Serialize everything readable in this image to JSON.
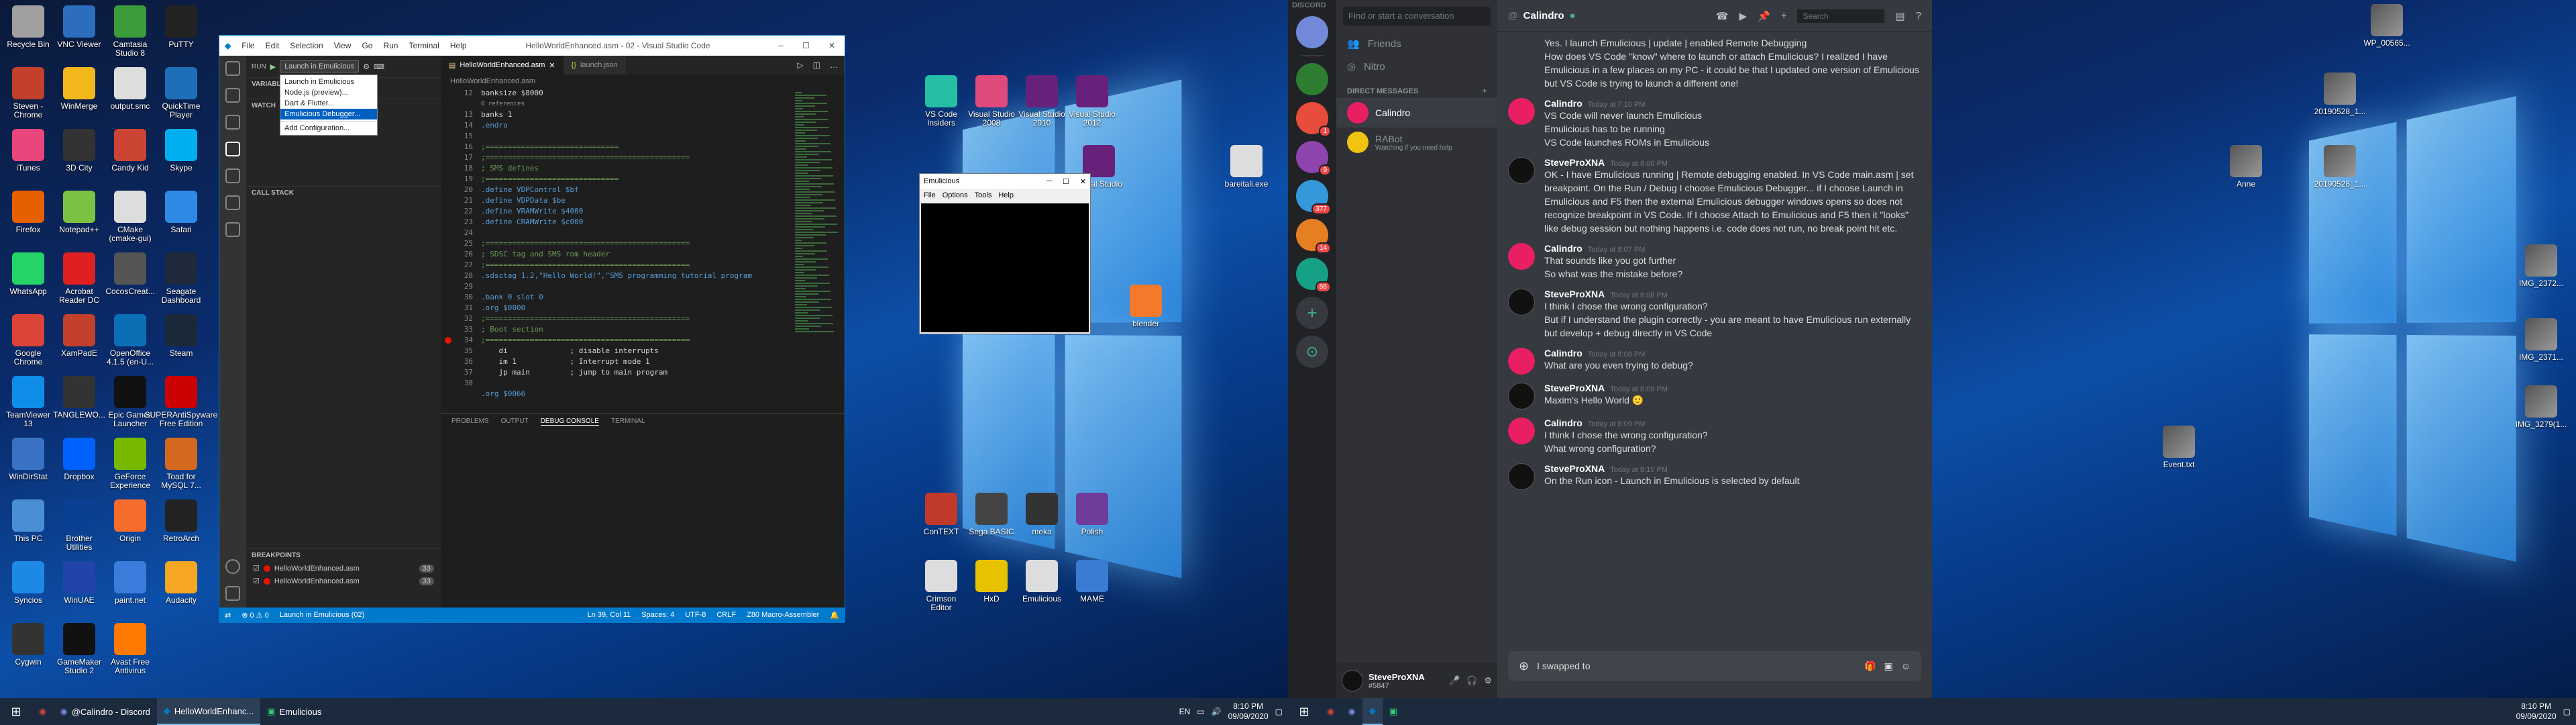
{
  "left_desktop": {
    "icons": [
      {
        "label": "Recycle Bin",
        "color": "#a0a0a0"
      },
      {
        "label": "VNC Viewer",
        "color": "#2c6ebd"
      },
      {
        "label": "Camtasia Studio 8",
        "color": "#3c9c3c"
      },
      {
        "label": "PuTTY",
        "color": "#222"
      },
      {
        "label": "Steven - Chrome",
        "color": "#c2402c"
      },
      {
        "label": "WinMerge",
        "color": "#f2b81b"
      },
      {
        "label": "output.smc",
        "color": "#ddd"
      },
      {
        "label": "QuickTime Player",
        "color": "#1f6fb8"
      },
      {
        "label": "iTunes",
        "color": "#e8467c"
      },
      {
        "label": "3D City",
        "color": "#333"
      },
      {
        "label": "Candy Kid",
        "color": "#c43"
      },
      {
        "label": "Skype",
        "color": "#00aff0"
      },
      {
        "label": "Firefox",
        "color": "#e66000"
      },
      {
        "label": "Notepad++",
        "color": "#7cc242"
      },
      {
        "label": "CMake (cmake-gui)",
        "color": "#ddd"
      },
      {
        "label": "Safari",
        "color": "#2d8be6"
      },
      {
        "label": "WhatsApp",
        "color": "#25d366"
      },
      {
        "label": "Acrobat Reader DC",
        "color": "#e02020"
      },
      {
        "label": "CocosCreat...",
        "color": "#555"
      },
      {
        "label": "Seagate Dashboard",
        "color": "#1e2a3c"
      },
      {
        "label": "Google Chrome",
        "color": "#db4437"
      },
      {
        "label": "XamPadE",
        "color": "#c2402c"
      },
      {
        "label": "OpenOffice 4.1.5 (en-U...",
        "color": "#0b6fb5"
      },
      {
        "label": "Steam",
        "color": "#1b2838"
      },
      {
        "label": "TeamViewer 13",
        "color": "#0e8ee9"
      },
      {
        "label": "TANGLEWO...",
        "color": "#333"
      },
      {
        "label": "Epic Games Launcher",
        "color": "#111"
      },
      {
        "label": "SUPERAntiSpyware Free Edition",
        "color": "#c00"
      },
      {
        "label": "WinDirStat",
        "color": "#3a72c3"
      },
      {
        "label": "Dropbox",
        "color": "#0061ff"
      },
      {
        "label": "GeForce Experience",
        "color": "#76b900"
      },
      {
        "label": "Toad for MySQL 7...",
        "color": "#d2691e"
      },
      {
        "label": "This PC",
        "color": "#4a8fd4"
      },
      {
        "label": "Brother Utilities",
        "color": "#0b3f91"
      },
      {
        "label": "Origin",
        "color": "#f56c2d"
      },
      {
        "label": "RetroArch",
        "color": "#222"
      },
      {
        "label": "Syncios",
        "color": "#1e88e5"
      },
      {
        "label": "WinUAE",
        "color": "#2244aa"
      },
      {
        "label": "paint.net",
        "color": "#3b7ddd"
      },
      {
        "label": "Audacity",
        "color": "#f5a623"
      },
      {
        "label": "Cygwin",
        "color": "#333"
      },
      {
        "label": "GameMaker Studio 2",
        "color": "#111"
      },
      {
        "label": "Avast Free Antivirus",
        "color": "#ff7800"
      }
    ],
    "mid_icons": [
      {
        "label": "VS Code Insiders",
        "color": "#24bfa5"
      },
      {
        "label": "Visual Studio 2008",
        "color": "#e04a7a"
      },
      {
        "label": "Visual Studio 2010",
        "color": "#68217a"
      },
      {
        "label": "Visual Studio 2012",
        "color": "#68217a"
      },
      {
        "label": "Visual Studio",
        "color": "#68217a"
      },
      {
        "label": "blender",
        "color": "#f5792a"
      },
      {
        "label": "bareitali.exe",
        "color": "#ddd"
      },
      {
        "label": "ConTEXT",
        "color": "#c0392b"
      },
      {
        "label": "Sega BASIC",
        "color": "#444"
      },
      {
        "label": "meka",
        "color": "#333"
      },
      {
        "label": "Polish",
        "color": "#6f3c9c"
      },
      {
        "label": "Crimson Editor",
        "color": "#ddd"
      },
      {
        "label": "HxD",
        "color": "#e6c200"
      },
      {
        "label": "Emulicious",
        "color": "#ddd"
      },
      {
        "label": "MAME",
        "color": "#3a7bd5"
      }
    ],
    "taskbar": {
      "items": [
        "@Calindro - Discord",
        "HelloWorldEnhanc...",
        "Emulicious"
      ],
      "lang": "EN",
      "time": "8:10 PM",
      "date": "09/09/2020"
    }
  },
  "vscode": {
    "title": "HelloWorldEnhanced.asm - 02 - Visual Studio Code",
    "menu": [
      "File",
      "Edit",
      "Selection",
      "View",
      "Go",
      "Run",
      "Terminal",
      "Help"
    ],
    "run_label": "RUN",
    "run_config": "Launch in Emulicious",
    "dropdown": [
      "Launch in Emulicious",
      "Node.js (preview)...",
      "Dart & Flutter...",
      "Emulicious Debugger...",
      "Add Configuration..."
    ],
    "sections": [
      "VARIABLES",
      "WATCH",
      "CALL STACK",
      "BREAKPOINTS"
    ],
    "breakpoints": [
      {
        "file": "HelloWorldEnhanced.asm",
        "line": "33"
      },
      {
        "file": "HelloWorldEnhanced.asm",
        "line": "33"
      }
    ],
    "tabs": [
      "HelloWorldEnhanced.asm",
      "launch.json"
    ],
    "breadcrumb": "HelloWorldEnhanced.asm",
    "line_numbers": [
      "12",
      "",
      "13",
      "14",
      "15",
      "16",
      "17",
      "18",
      "19",
      "20",
      "21",
      "22",
      "23",
      "24",
      "25",
      "26",
      "27",
      "28",
      "29",
      "30",
      "31",
      "32",
      "33",
      "34",
      "35",
      "36",
      "37",
      "38"
    ],
    "code_lines": [
      "banksize $8000",
      "0 references",
      "banks 1",
      ".endro",
      "",
      ";==============================",
      ";==============================================",
      "; SMS defines",
      ";==============================",
      ".define VDPControl $bf",
      ".define VDPData $be",
      ".define VRAMWrite $4000",
      ".define CRAMWrite $c000",
      "",
      ";==============================================",
      "; SDSC tag and SMS rom header",
      ";==============================================",
      ".sdsctag 1.2,\"Hello World!\",\"SMS programming tutorial program",
      "",
      ".bank 0 slot 0",
      ".org $0000",
      ";==============================================",
      "; Boot section",
      ";==============================================",
      "    di              ; disable interrupts",
      "    im 1            ; Interrupt mode 1",
      "    jp main         ; jump to main program",
      "",
      ".org $0066"
    ],
    "panel_tabs": [
      "PROBLEMS",
      "OUTPUT",
      "DEBUG CONSOLE",
      "TERMINAL"
    ],
    "status": {
      "errors": "⊗ 0 ⚠ 0",
      "launch": "Launch in Emulicious (02)",
      "position": "Ln 39, Col 11",
      "spaces": "Spaces: 4",
      "encoding": "UTF-8",
      "eol": "CRLF",
      "lang": "Z80 Macro-Assembler"
    }
  },
  "emulicious": {
    "title": "Emulicious",
    "menu": [
      "File",
      "Options",
      "Tools",
      "Help"
    ]
  },
  "right_desktop": {
    "icons": [
      {
        "label": "WP_00565..."
      },
      {
        "label": "20190528_1..."
      },
      {
        "label": "Anne"
      },
      {
        "label": "20190528_1..."
      },
      {
        "label": "IMG_2372..."
      },
      {
        "label": "IMG_2371..."
      },
      {
        "label": "IMG_3279(1..."
      },
      {
        "label": "Event.txt"
      }
    ],
    "taskbar": {
      "time": "8:10 PM",
      "date": "09/09/2020"
    }
  },
  "discord": {
    "app_name": "DISCORD",
    "search_placeholder": "Find or start a conversation",
    "nav": [
      "Friends",
      "Nitro"
    ],
    "dm_header": "DIRECT MESSAGES",
    "dms": [
      {
        "name": "Calindro",
        "sub": ""
      },
      {
        "name": "RABot",
        "sub": "Watching if you need help"
      }
    ],
    "guild_badges": [
      "1",
      "9",
      "377",
      "14",
      "56"
    ],
    "user": {
      "name": "SteveProXNA",
      "tag": "#5847"
    },
    "channel_title": "Calindro",
    "chat_search": "Search",
    "messages": [
      {
        "author": "",
        "time": "",
        "lines": [
          "Yes.  I launch Emulicious | update | enabled Remote Debugging",
          "How does VS Code \"know\" where to launch or attach Emulicious?  I realized I have Emulicious in a few places on my PC - it could be that I updated one version of Emulicious but VS Code is trying to launch a different one!"
        ]
      },
      {
        "author": "Calindro",
        "time": "Today at 7:10 PM",
        "lines": [
          "VS Code will never launch Emulicious",
          "Emulicious has to be running",
          "VS Code launches ROMs in Emulicious"
        ]
      },
      {
        "author": "SteveProXNA",
        "time": "Today at 8:00 PM",
        "lines": [
          "OK - I have Emulicious running | Remote debugging enabled.  In VS Code main.asm | set breakpoint.  On the Run / Debug I choose Emulicious Debugger... if I choose Launch in Emulicious and F5 then the external Emulicious debugger windows opens so does not recognize breakpoint in VS Code.  If I choose Attach to Emulicious and F5 then it \"looks\" like debug session but nothing happens i.e. code does not run, no break point hit etc."
        ]
      },
      {
        "author": "Calindro",
        "time": "Today at 8:07 PM",
        "lines": [
          "That sounds like you got further",
          "So what was the mistake before?"
        ]
      },
      {
        "author": "SteveProXNA",
        "time": "Today at 8:08 PM",
        "lines": [
          "I think I chose the wrong configuration?",
          "But if I understand the plugin correctly - you are meant to have Emulicious run externally but develop + debug directly in VS Code"
        ]
      },
      {
        "author": "Calindro",
        "time": "Today at 8:08 PM",
        "lines": [
          "What are you even trying to debug?"
        ]
      },
      {
        "author": "SteveProXNA",
        "time": "Today at 8:09 PM",
        "lines": [
          "Maxim's Hello World 🙂"
        ]
      },
      {
        "author": "Calindro",
        "time": "Today at 8:09 PM",
        "lines": [
          "I think I chose the wrong configuration?",
          "What wrong configuration?"
        ]
      },
      {
        "author": "SteveProXNA",
        "time": "Today at 8:10 PM",
        "lines": [
          "On the Run icon - Launch in Emulicious is selected by default"
        ]
      }
    ],
    "composer_text": "I swapped to"
  }
}
